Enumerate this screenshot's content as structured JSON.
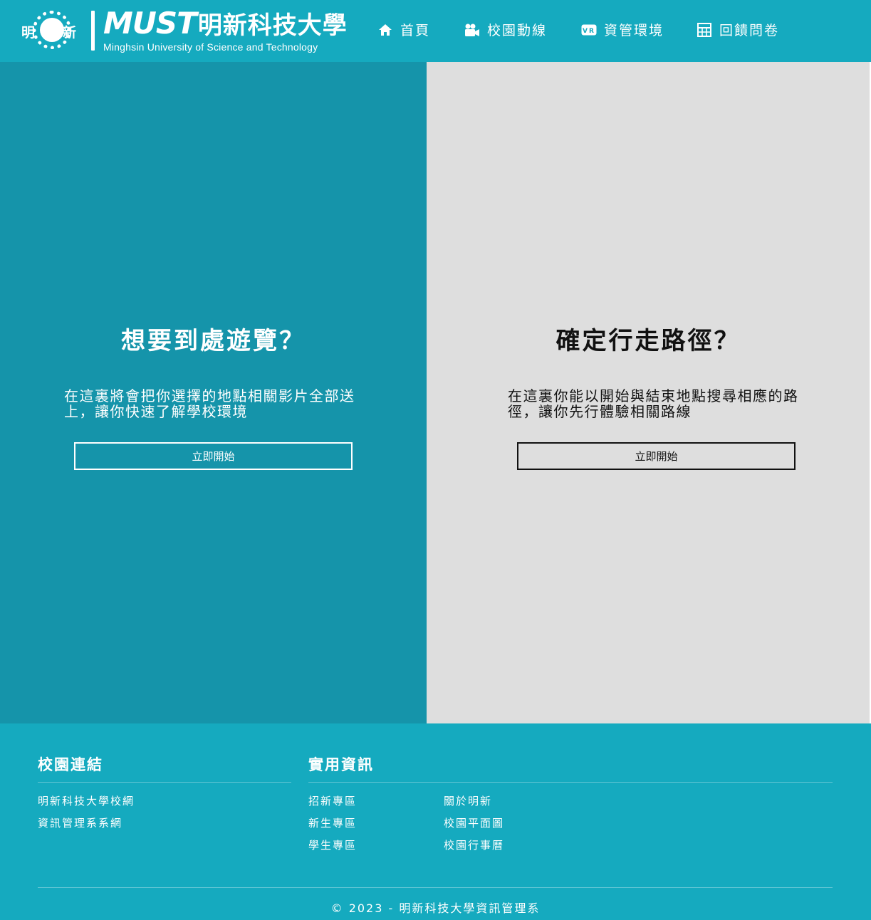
{
  "brand": {
    "seal_left": "明",
    "seal_right": "新",
    "must": "MUST",
    "name_cn": "明新科技大學",
    "name_en": "Minghsin University of Science and Technology"
  },
  "nav": [
    {
      "label": "首頁",
      "icon": "home-icon"
    },
    {
      "label": "校園動線",
      "icon": "video-camera-icon"
    },
    {
      "label": "資管環境",
      "icon": "vr-icon"
    },
    {
      "label": "回饋問卷",
      "icon": "table-icon"
    }
  ],
  "panels": {
    "left": {
      "title": "想要到處遊覽？",
      "desc": "在這裏將會把你選擇的地點相關影片全部送上，讓你快速了解學校環境",
      "button": "立即開始"
    },
    "right": {
      "title": "確定行走路徑？",
      "desc": "在這裏你能以開始與結束地點搜尋相應的路徑，讓你先行體驗相關路線",
      "button": "立即開始"
    }
  },
  "footer": {
    "campus_links": {
      "title": "校園連結",
      "items": [
        "明新科技大學校網",
        "資訊管理系系網"
      ]
    },
    "useful_info": {
      "title": "實用資訊",
      "col1": [
        "招新專區",
        "新生專區",
        "學生專區"
      ],
      "col2": [
        "關於明新",
        "校園平面圖",
        "校園行事曆"
      ]
    },
    "copyright": "© 2023 - 明新科技大學資訊管理系"
  },
  "colors": {
    "header_bg": "#15aabf",
    "left_panel_bg": "#1594aa",
    "right_panel_bg": "#dedede"
  }
}
